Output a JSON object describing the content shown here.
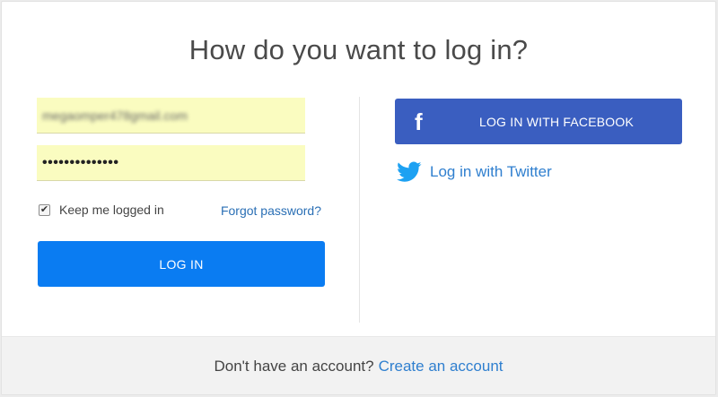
{
  "title": "How do you want to log in?",
  "form": {
    "email_value": "megaomper478gmail.com",
    "password_value": "••••••••••••••",
    "remember_checked": true,
    "remember_label": "Keep me logged in",
    "forgot_label": "Forgot password?",
    "login_label": "LOG IN"
  },
  "social": {
    "facebook_label": "LOG IN WITH FACEBOOK",
    "facebook_icon": "f",
    "twitter_label": "Log in with Twitter"
  },
  "footer": {
    "prompt": "Don't have an account?",
    "create_label": "Create an account"
  },
  "colors": {
    "primary": "#0a7cf2",
    "facebook": "#3a5ec0",
    "link": "#2f7fcf",
    "autofill": "#fafcc0"
  }
}
